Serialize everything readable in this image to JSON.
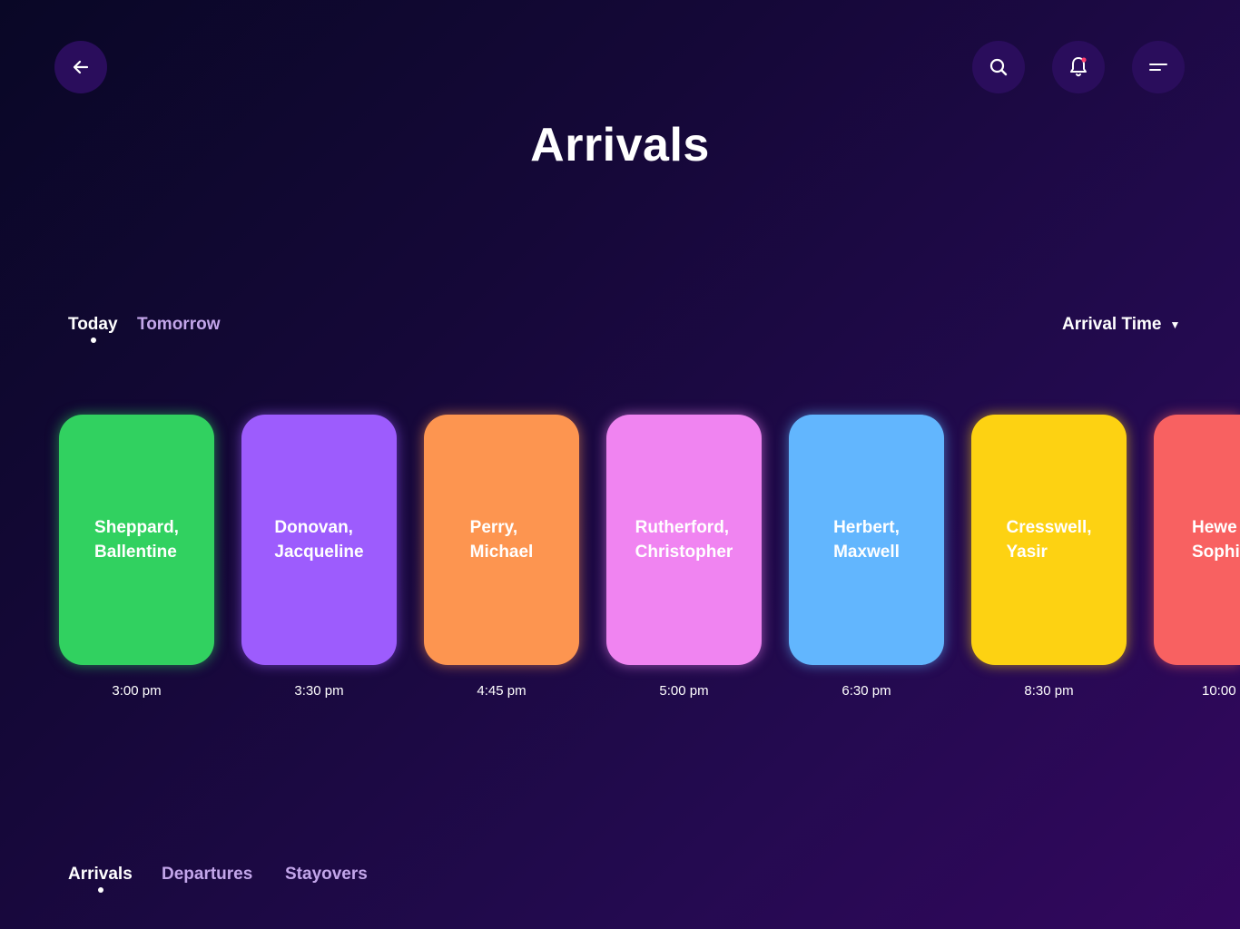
{
  "header": {
    "title": "Arrivals",
    "back_icon": "arrow-left-icon",
    "search_icon": "search-icon",
    "bell_icon": "bell-icon",
    "menu_icon": "menu-icon",
    "notification_dot_color": "#ff3d6e"
  },
  "day_tabs": [
    {
      "label": "Today",
      "active": true
    },
    {
      "label": "Tomorrow",
      "active": false
    }
  ],
  "sort": {
    "label": "Arrival Time",
    "caret_icon": "caret-down-icon"
  },
  "guests": [
    {
      "last": "Sheppard,",
      "first": "Ballentine",
      "time": "3:00 pm",
      "color": "#31d160"
    },
    {
      "last": "Donovan,",
      "first": "Jacqueline",
      "time": "3:30 pm",
      "color": "#9d5cfd"
    },
    {
      "last": "Perry,",
      "first": "Michael",
      "time": "4:45 pm",
      "color": "#fd9550"
    },
    {
      "last": "Rutherford,",
      "first": "Christopher",
      "time": "5:00 pm",
      "color": "#f084f1"
    },
    {
      "last": "Herbert,",
      "first": "Maxwell",
      "time": "6:30 pm",
      "color": "#62b6fe"
    },
    {
      "last": "Cresswell,",
      "first": "Yasir",
      "time": "8:30 pm",
      "color": "#fdd212"
    },
    {
      "last": "Hewe",
      "first": "Sophi",
      "time": "10:00",
      "color": "#f86161"
    }
  ],
  "bottom_tabs": [
    {
      "label": "Arrivals",
      "active": true
    },
    {
      "label": "Departures",
      "active": false
    },
    {
      "label": "Stayovers",
      "active": false
    }
  ],
  "colors": {
    "button_bg": "#2a0d5c",
    "inactive_tab": "#c3a6ea"
  }
}
